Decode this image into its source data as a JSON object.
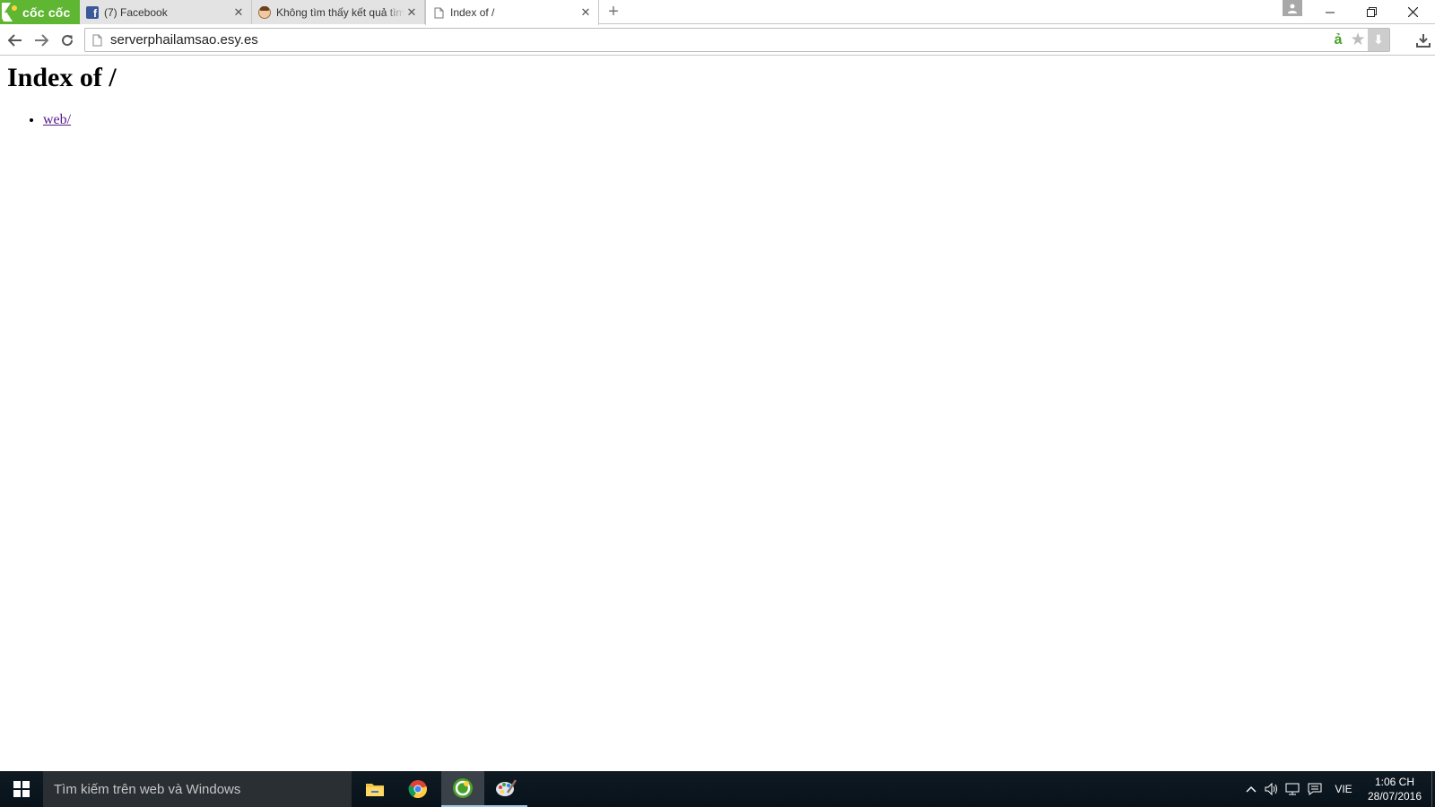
{
  "browser": {
    "brand": "cốc cốc",
    "tabs": [
      {
        "title": "(7) Facebook",
        "favicon": "facebook-icon",
        "active": false
      },
      {
        "title": "Không tìm thấy kết quả tìm",
        "favicon": "face-icon",
        "active": false
      },
      {
        "title": "Index of /",
        "favicon": "page-icon",
        "active": true
      }
    ],
    "close_glyph": "✕",
    "new_tab_glyph": "+",
    "address": {
      "url": "serverphailamsao.esy.es"
    },
    "addon_letter": "ả"
  },
  "page": {
    "heading": "Index of /",
    "links": [
      {
        "text": "web/"
      }
    ],
    "link_color": "#551a8b"
  },
  "taskbar": {
    "search_placeholder": "Tìm kiếm trên web và Windows",
    "apps": [
      "file-explorer",
      "chrome",
      "coccoc",
      "paint"
    ],
    "language": "VIE",
    "time": "1:06 CH",
    "date": "28/07/2016"
  },
  "colors": {
    "brand_green": "#5fb632",
    "facebook_blue": "#3b5998",
    "taskbar_bg": "#0f1a22"
  }
}
